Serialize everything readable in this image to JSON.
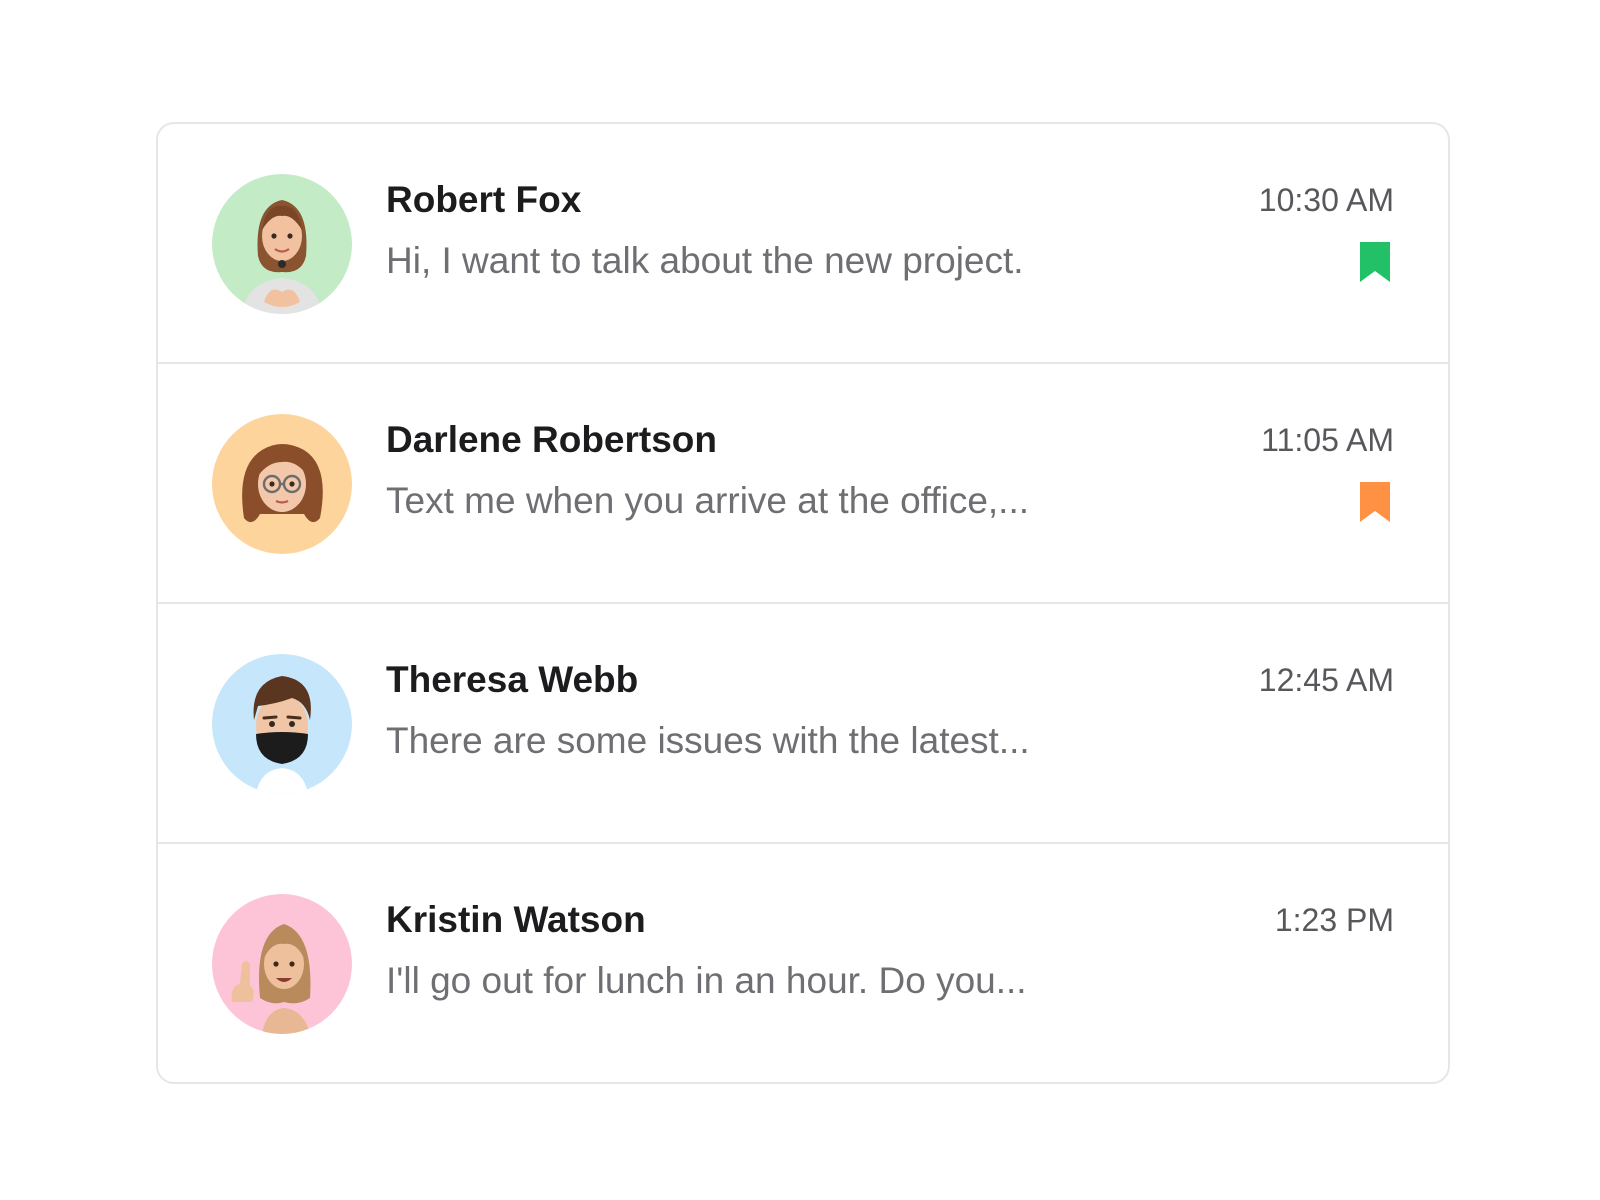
{
  "messages": [
    {
      "name": "Robert Fox",
      "time": "10:30 AM",
      "preview": "Hi, I want to talk about the new project.",
      "avatar_bg": "#c3ebc6",
      "avatar_icon": "avatar-woman-heart-hands",
      "bookmark_color": "#22c067"
    },
    {
      "name": "Darlene Robertson",
      "time": "11:05 AM",
      "preview": "Text me when you arrive at the office,...",
      "avatar_bg": "#fdd49c",
      "avatar_icon": "avatar-woman-glasses",
      "bookmark_color": "#ff9145"
    },
    {
      "name": "Theresa Webb",
      "time": "12:45 AM",
      "preview": "There are some issues with the latest...",
      "avatar_bg": "#c6e6fb",
      "avatar_icon": "avatar-man-mask",
      "bookmark_color": null
    },
    {
      "name": "Kristin Watson",
      "time": "1:23 PM",
      "preview": "I'll go out for lunch in an hour. Do you...",
      "avatar_bg": "#fcc4d6",
      "avatar_icon": "avatar-woman-raised-finger",
      "bookmark_color": null
    }
  ]
}
